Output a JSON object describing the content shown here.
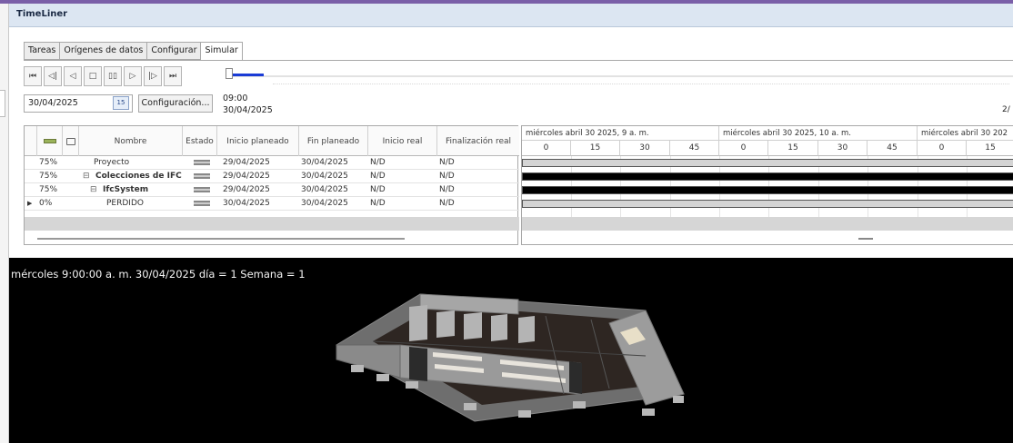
{
  "window": {
    "title": "TimeLiner"
  },
  "tabs": [
    {
      "label": "Tareas"
    },
    {
      "label": "Orígenes de datos"
    },
    {
      "label": "Configurar"
    },
    {
      "label": "Simular"
    }
  ],
  "playback": {
    "buttons": [
      "first-frame",
      "step-back",
      "play-reverse",
      "stop",
      "pause",
      "play",
      "step-forward",
      "last-frame"
    ]
  },
  "date_picker": {
    "value": "30/04/2025",
    "calendar_day": "15"
  },
  "config_button": "Configuración...",
  "current_time": {
    "time": "09:00",
    "date": "30/04/2025"
  },
  "page_indicator": "2/",
  "grid": {
    "columns": [
      "",
      "",
      "Nombre",
      "Estado",
      "Inicio planeado",
      "Fin planeado",
      "Inicio real",
      "Finalización real"
    ],
    "rows": [
      {
        "pct": "75%",
        "name": "Proyecto",
        "expander": "",
        "bold": false,
        "start": "29/04/2025",
        "end": "30/04/2025",
        "real_start": "N/D",
        "real_end": "N/D",
        "selected": false
      },
      {
        "pct": "75%",
        "name": "Colecciones de IFC",
        "expander": "⊟",
        "bold": true,
        "start": "29/04/2025",
        "end": "30/04/2025",
        "real_start": "N/D",
        "real_end": "N/D",
        "selected": false
      },
      {
        "pct": "75%",
        "name": "IfcSystem",
        "expander": "⊟",
        "bold": true,
        "start": "29/04/2025",
        "end": "30/04/2025",
        "real_start": "N/D",
        "real_end": "N/D",
        "selected": false
      },
      {
        "pct": "0%",
        "name": "PERDIDO",
        "expander": "",
        "bold": false,
        "start": "30/04/2025",
        "end": "30/04/2025",
        "real_start": "N/D",
        "real_end": "N/D",
        "selected": true
      }
    ]
  },
  "gantt": {
    "hour_headers": [
      "miércoles abril 30 2025, 9 a. m.",
      "miércoles abril 30 2025, 10 a. m.",
      "miércoles abril 30 202"
    ],
    "minute_ticks": [
      "0",
      "15",
      "30",
      "45",
      "0",
      "15",
      "30",
      "45",
      "0",
      "15"
    ],
    "bars": [
      {
        "style": "gray"
      },
      {
        "style": "black"
      },
      {
        "style": "black"
      },
      {
        "style": "gray"
      }
    ]
  },
  "viewport": {
    "overlay_text": "mércoles 9:00:00 a. m. 30/04/2025 día = 1 Semana = 1"
  },
  "colors": {
    "title_bar": "#dce6f2",
    "slider_fill": "#1a3bd6",
    "viewport_bg": "#000000",
    "bar_black": "#000000",
    "bar_gray": "#d4d4d4"
  }
}
